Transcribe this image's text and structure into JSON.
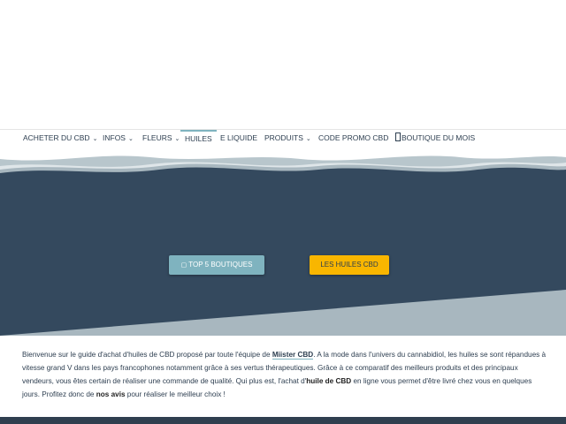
{
  "nav": {
    "items": [
      {
        "label": "ACHETER DU CBD",
        "dropdown": true
      },
      {
        "label": "INFOS",
        "dropdown": true
      },
      {
        "label": "FLEURS",
        "dropdown": true
      },
      {
        "label": "HUILES",
        "dropdown": false,
        "active": true
      },
      {
        "label": "E LIQUIDE",
        "dropdown": false
      },
      {
        "label": "PRODUITS",
        "dropdown": true
      },
      {
        "label": "CODE PROMO CBD",
        "dropdown": false
      },
      {
        "label": "BOUTIQUE DU MOIS",
        "dropdown": false,
        "icon": "tag-icon"
      }
    ]
  },
  "hero": {
    "button_top": "TOP 5 BOUTIQUES",
    "button_top_icon": "star-icon",
    "button_huiles": "LES HUILES CBD",
    "background_color": "#34495e",
    "accent_color": "#7fb3bf",
    "cta_color": "#f9b600"
  },
  "intro": {
    "p1": "Bienvenue sur le guide d'achat d'huiles de CBD proposé par toute l'équipe de ",
    "brand": "Miister CBD",
    "p2": ". A la mode dans l'univers du cannabidiol, les huiles se sont répandues à vitesse grand V dans les pays francophones notamment grâce à ses vertus thérapeutiques. Grâce à ce comparatif des meilleurs produits et des principaux vendeurs, vous êtes certain de réaliser une commande de qualité. Qui plus est, l'achat d'",
    "bold1": "huile de CBD",
    "p3": " en ligne vous permet d'être livré chez vous en quelques jours. Profitez donc de ",
    "bold2": "nos avis",
    "p4": " pour réaliser le meilleur choix !"
  }
}
